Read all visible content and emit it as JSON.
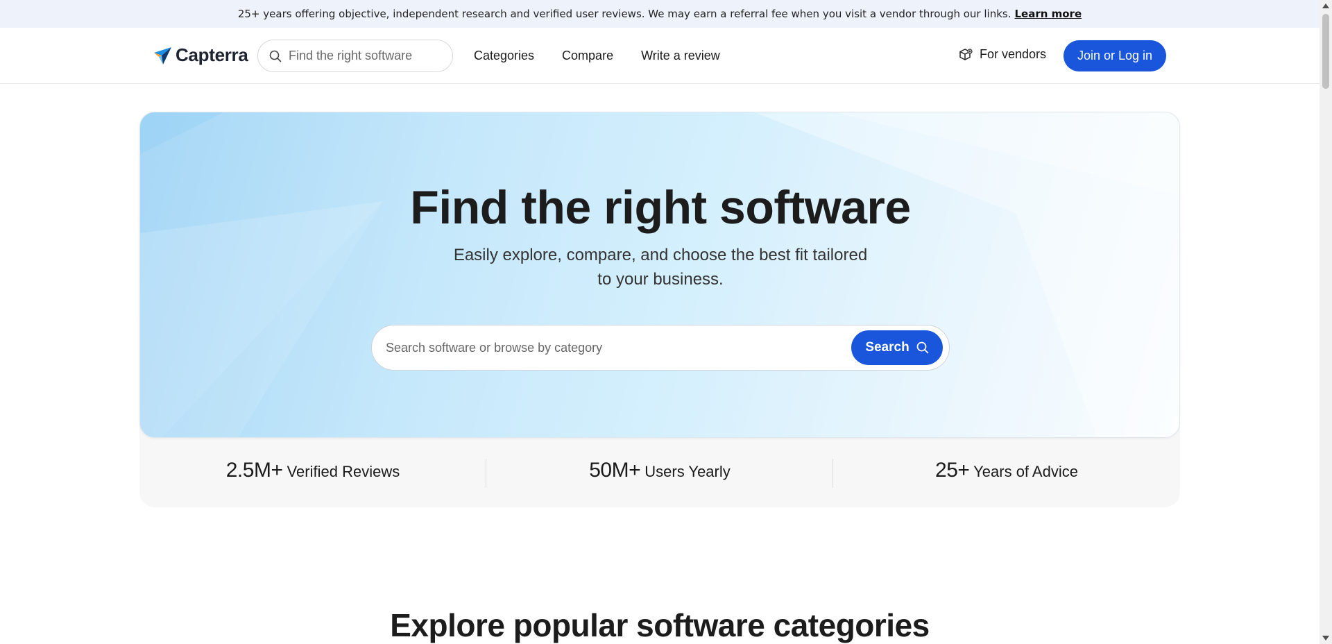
{
  "notice": {
    "text": "25+ years offering objective, independent research and verified user reviews. We may earn a referral fee when you visit a vendor through our links.",
    "link": "Learn more"
  },
  "header": {
    "logo_text": "Capterra",
    "search_placeholder": "Find the right software",
    "nav": [
      {
        "label": "Categories"
      },
      {
        "label": "Compare"
      },
      {
        "label": "Write a review"
      }
    ],
    "vendors_label": "For vendors",
    "join_label": "Join or Log in"
  },
  "hero": {
    "title": "Find the right software",
    "subtitle": "Easily explore, compare, and choose the best fit tailored to your business.",
    "search_placeholder": "Search software or browse by category",
    "search_button": "Search"
  },
  "stats": [
    {
      "number": "2.5M+",
      "label": "Verified Reviews"
    },
    {
      "number": "50M+",
      "label": "Users Yearly"
    },
    {
      "number": "25+",
      "label": "Years of Advice"
    }
  ],
  "section_title": "Explore popular software categories",
  "colors": {
    "primary": "#1a56db",
    "notice_bg": "#eef2fb",
    "logo_blue": "#1a8fe3",
    "logo_orange": "#ff9d28"
  }
}
